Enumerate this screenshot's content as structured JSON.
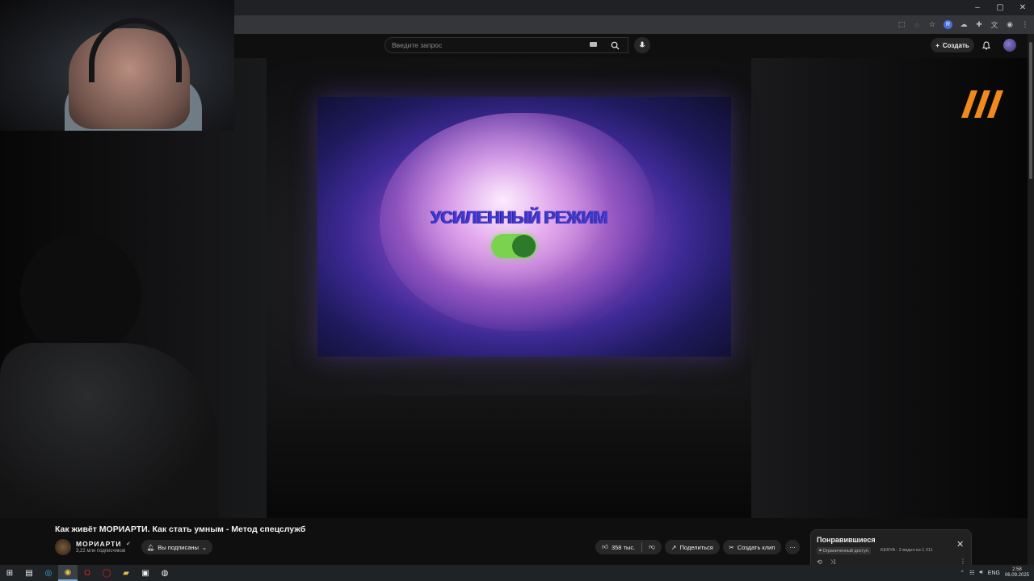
{
  "browser": {
    "window_controls": [
      "–",
      "▢",
      "✕"
    ]
  },
  "search": {
    "placeholder": "Введите запрос"
  },
  "header": {
    "create_label": "Создать"
  },
  "video": {
    "overlay_text": "УСИЛЕННЫЙ РЕЖИМ",
    "toggle_state": "on",
    "accent_color": "#7bd24e",
    "logo_color": "#f08a1e"
  },
  "info": {
    "title": "Как живёт МОРИАРТИ. Как стать умным - Метод спецслужб",
    "channel_name": "МОРИАРТИ",
    "verified_icon": "verified-icon",
    "subscribers": "3,22 млн подписчиков",
    "subscribe_label": "Вы подписаны",
    "likes": "358 тыс.",
    "share_label": "Поделиться",
    "clip_label": "Создать клип"
  },
  "playlist": {
    "title": "Понравившиеся",
    "access": "Ограниченный доступ",
    "meta": "KERYA - 2 видео из 1 211"
  },
  "taskbar": {
    "lang": "ENG",
    "time": "2:58",
    "date": "06.09.2025"
  }
}
